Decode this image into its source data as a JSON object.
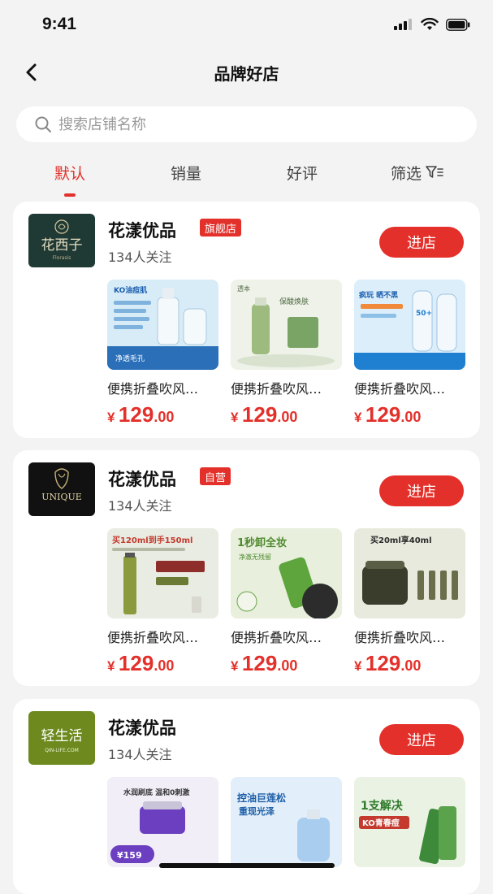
{
  "status_bar": {
    "time": "9:41"
  },
  "nav": {
    "title": "品牌好店"
  },
  "search": {
    "placeholder": "搜索店铺名称"
  },
  "tabs": [
    {
      "label": "默认",
      "active": true
    },
    {
      "label": "销量",
      "active": false
    },
    {
      "label": "好评",
      "active": false
    },
    {
      "label": "筛选",
      "active": false
    }
  ],
  "colors": {
    "accent": "#e3302a",
    "background": "#f3f3f3"
  },
  "shops": [
    {
      "name": "花漾优品",
      "badge": "旗舰店",
      "followers": "134人关注",
      "enter_label": "进店",
      "logo_text": "花西子",
      "logo_sub": "Florasis",
      "products": [
        {
          "name": "便携折叠吹风…",
          "currency": "¥",
          "price_int": "129",
          "price_dec": ".00",
          "tag1": "KO油痘肌",
          "tag2": "净透毛孔"
        },
        {
          "name": "便携折叠吹风…",
          "currency": "¥",
          "price_int": "129",
          "price_dec": ".00",
          "tag1": "透本",
          "tag2": "保酸焕肤"
        },
        {
          "name": "便携折叠吹风…",
          "currency": "¥",
          "price_int": "129",
          "price_dec": ".00",
          "tag1": "疯玩 晒不黑",
          "tag2": "50+"
        }
      ]
    },
    {
      "name": "花漾优品",
      "badge": "自营",
      "followers": "134人关注",
      "enter_label": "进店",
      "logo_text": "UNIQUE",
      "logo_sub": "",
      "products": [
        {
          "name": "便携折叠吹风…",
          "currency": "¥",
          "price_int": "129",
          "price_dec": ".00",
          "tag1": "买120ml到手150ml",
          "tag2": ""
        },
        {
          "name": "便携折叠吹风…",
          "currency": "¥",
          "price_int": "129",
          "price_dec": ".00",
          "tag1": "1秒卸全妆",
          "tag2": "净澈无残留"
        },
        {
          "name": "便携折叠吹风…",
          "currency": "¥",
          "price_int": "129",
          "price_dec": ".00",
          "tag1": "买20ml享40ml",
          "tag2": ""
        }
      ]
    },
    {
      "name": "花漾优品",
      "badge": "",
      "followers": "134人关注",
      "enter_label": "进店",
      "logo_text": "轻生活",
      "logo_sub": "QIN-LIFE.COM",
      "products": [
        {
          "name": "",
          "currency": "",
          "price_int": "",
          "price_dec": "",
          "tag1": "水润刷底 温和0刺激",
          "tag2": "¥159"
        },
        {
          "name": "",
          "currency": "",
          "price_int": "",
          "price_dec": "",
          "tag1": "控油巨莲松",
          "tag2": "重现光泽"
        },
        {
          "name": "",
          "currency": "",
          "price_int": "",
          "price_dec": "",
          "tag1": "1支解决",
          "tag2": "KO青春痘"
        }
      ]
    }
  ]
}
